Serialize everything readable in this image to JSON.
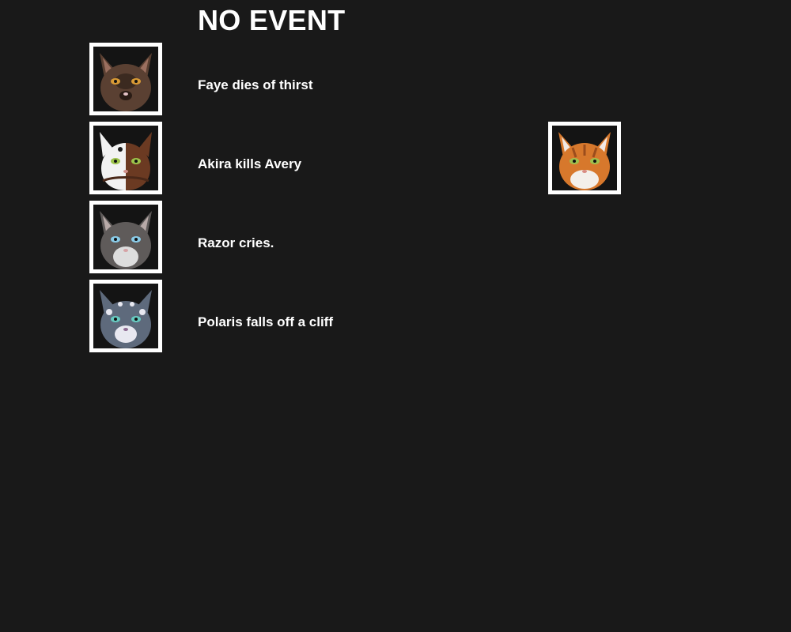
{
  "title": "NO EVENT",
  "events": [
    {
      "text": "Faye dies of thirst",
      "avatar": "brown-cat-portrait-icon",
      "fur": "#5a4032",
      "accent": "#3b2a20",
      "eyes": "#d89a35"
    },
    {
      "text": "Akira kills Avery",
      "avatar": "white-brown-cat-portrait-icon",
      "fur": "#6b3a22",
      "accent": "#f2f2f2",
      "eyes": "#9cc24a",
      "secondary_avatar": "orange-tabby-cat-portrait-icon",
      "secondary_fur": "#d7782c",
      "secondary_eyes": "#9ec04d"
    },
    {
      "text": "Razor cries.",
      "avatar": "grey-cat-portrait-icon",
      "fur": "#5f5b5a",
      "accent": "#dddddd",
      "eyes": "#89cbe8"
    },
    {
      "text": "Polaris falls off a cliff",
      "avatar": "blue-grey-cat-portrait-icon",
      "fur": "#5e6a7c",
      "accent": "#e8e8f0",
      "eyes": "#66c9c0"
    }
  ]
}
